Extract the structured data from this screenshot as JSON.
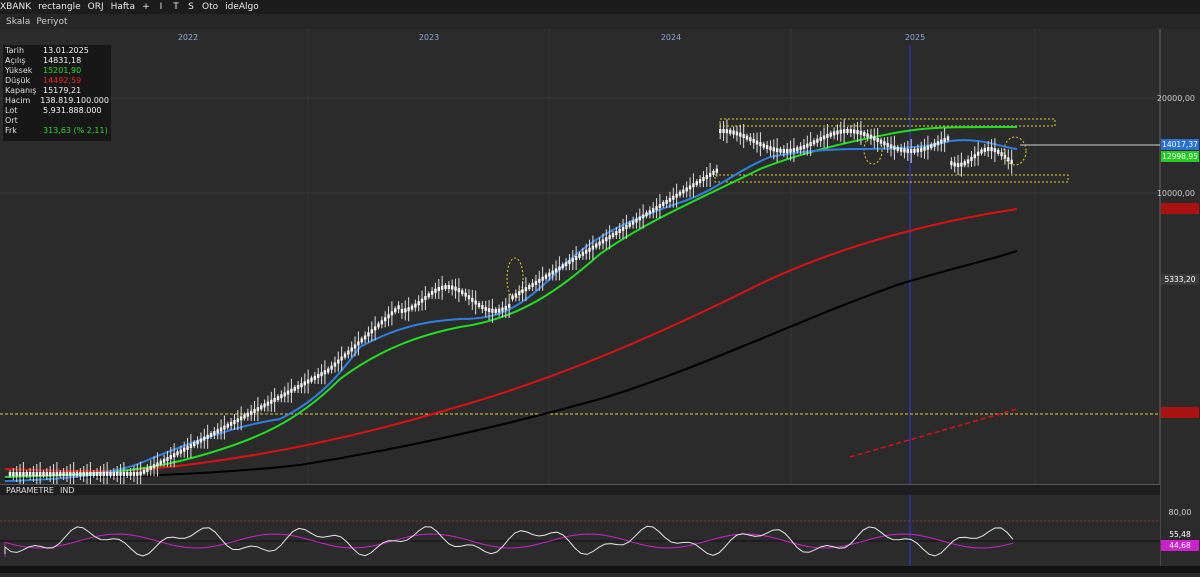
{
  "topbar": {
    "items": [
      "XBANK",
      "rectangle",
      "ORJ",
      "Hafta",
      "+",
      "I",
      "T",
      "S",
      "Oto",
      "ideAlgo"
    ]
  },
  "toolbar": {
    "skala": "Skala",
    "periyot": "Periyot"
  },
  "info": {
    "rows": [
      {
        "k": "Tarih",
        "v": "13.01.2025",
        "color": "#f0f0f0"
      },
      {
        "k": "Açılış",
        "v": "14831,18",
        "color": "#f0f0f0"
      },
      {
        "k": "Yüksek",
        "v": "15201,90",
        "color": "#22dd22"
      },
      {
        "k": "Düşük",
        "v": "14492,59",
        "color": "#ee2222"
      },
      {
        "k": "Kapanış",
        "v": "15179,21",
        "color": "#f0f0f0"
      },
      {
        "k": "Hacim",
        "v": "138.819.100.000",
        "color": "#f0f0f0"
      },
      {
        "k": "Lot",
        "v": "5.931.888.000",
        "color": "#f0f0f0"
      },
      {
        "k": "Ort",
        "v": "",
        "color": "#f0f0f0"
      },
      {
        "k": "Frk",
        "v": "313,63 (% 2,11)",
        "color": "#22dd22"
      }
    ]
  },
  "indicator_bar": {
    "label1": "PARAMETRE",
    "label2": "IND"
  },
  "chart_data": {
    "type": "line",
    "x_axis_years": [
      "2022",
      "2023",
      "2024",
      "2025"
    ],
    "y_axis": {
      "scale": "log",
      "ticks": [
        "20000,00",
        "10000,00"
      ]
    },
    "price_tags": [
      {
        "label": "14017,37",
        "color": "#2a6fd6",
        "text_color": "#ffffff"
      },
      {
        "label": "12998,95",
        "color": "#22cc22",
        "text_color": "#ffffff"
      },
      {
        "label": "5333,20",
        "color": "#3a3a3a",
        "text_color": "#ffffff"
      }
    ],
    "series": [
      {
        "color": "#2f7fe0"
      },
      {
        "color": "#22dd22"
      },
      {
        "color": "#dd1111"
      },
      {
        "color": "#000000"
      }
    ],
    "indicator": {
      "levels": [
        "80,00"
      ],
      "tags": [
        {
          "label": "55,48",
          "color": "#2a2a2a"
        },
        {
          "label": "44,68",
          "color": "#cc22cc"
        }
      ]
    },
    "grid": true
  }
}
